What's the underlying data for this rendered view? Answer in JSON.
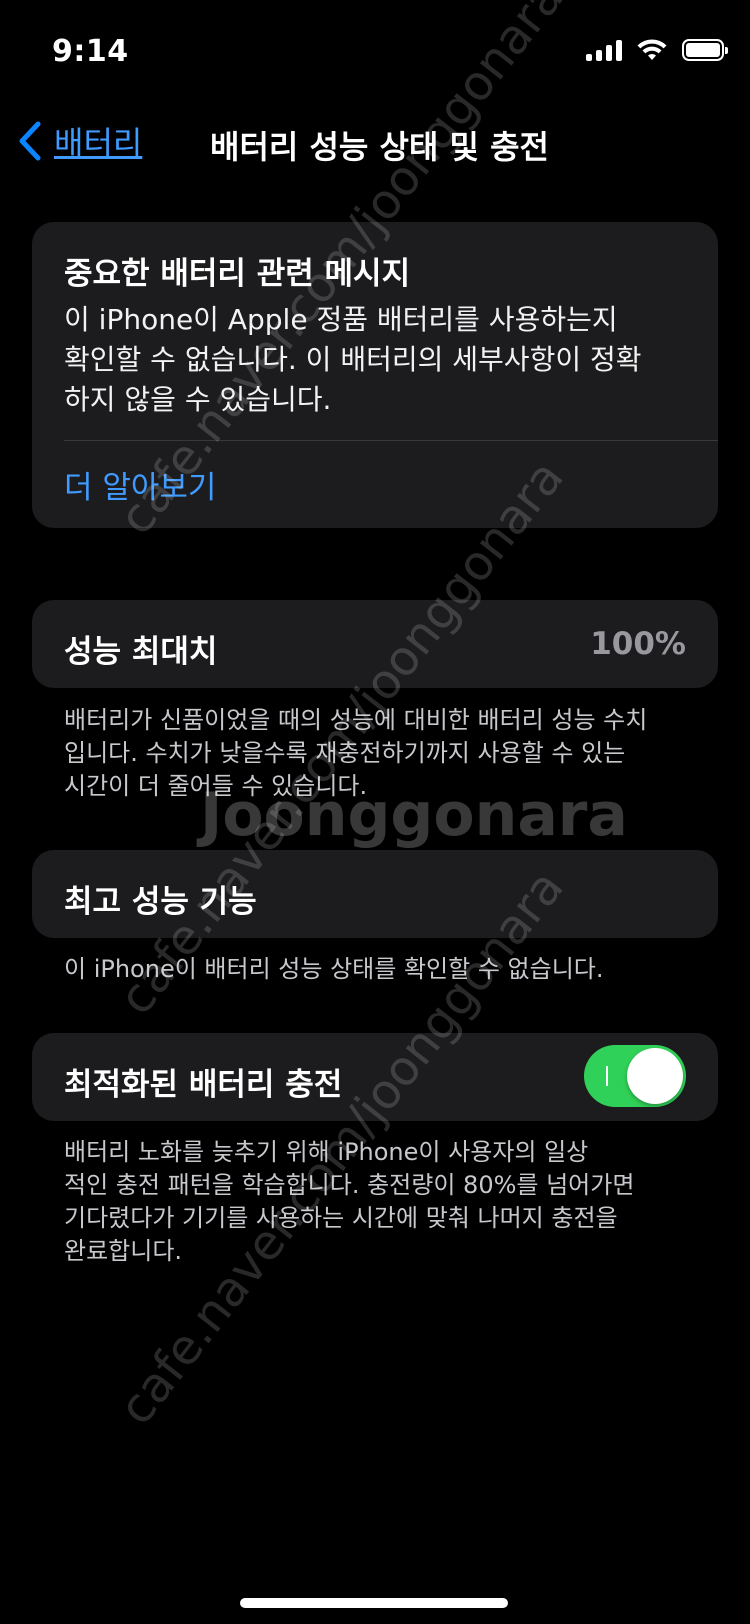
{
  "status_bar": {
    "time": "9:14"
  },
  "nav": {
    "back_label": "배터리",
    "title": "배터리 성능 상태 및 충전"
  },
  "alert": {
    "title": "중요한 배터리 관련 메시지",
    "body_lines": [
      "이 iPhone이 Apple 정품 배터리를 사용하는지",
      "확인할 수 없습니다. 이 배터리의 세부사항이 정확",
      "하지 않을 수 있습니다."
    ],
    "link": "더 알아보기"
  },
  "maximum_capacity": {
    "label": "성능 최대치",
    "value": "100%",
    "footnote_lines": [
      "배터리가 신품이었을 때의 성능에 대비한 배터리 성능 수치",
      "입니다. 수치가 낮을수록 재충전하기까지 사용할 수 있는",
      "시간이 더 줄어들 수 있습니다."
    ]
  },
  "peak_performance": {
    "label": "최고 성능 기능",
    "footnote_lines": [
      "이 iPhone이 배터리 성능 상태를 확인할 수 없습니다."
    ]
  },
  "optimized_charging": {
    "label": "최적화된 배터리 충전",
    "enabled": true,
    "footnote_lines": [
      "배터리 노화를 늦추기 위해 iPhone이 사용자의 일상",
      "적인 충전 패턴을 학습합니다. 충전량이 80%를 넘어가면",
      "기다렸다가 기기를 사용하는 시간에 맞춰 나머지 충전을",
      "완료합니다."
    ]
  },
  "watermarks": {
    "site": "cafe.naver.com/joonggonara",
    "logo": "Joonggonara"
  },
  "colors": {
    "background": "#000000",
    "card": "#1c1c1e",
    "accent_blue": "#0a84ff",
    "toggle_on": "#30d158",
    "secondary_text": "#98989d"
  },
  "icons": {
    "back": "chevron-left-icon",
    "signal": "cellular-signal-icon",
    "wifi": "wifi-icon",
    "battery": "battery-full-icon"
  }
}
